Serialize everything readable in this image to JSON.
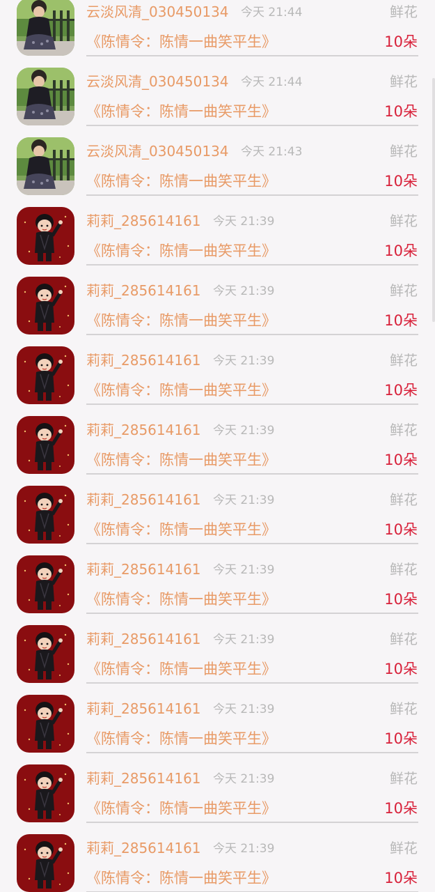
{
  "colors": {
    "name": "#e89a66",
    "book": "#e89a66",
    "time": "#b8b8b8",
    "gift_type": "#b8b8b8",
    "count": "#d8213a",
    "divider": "#d4d2d4",
    "background": "#f7f5f7"
  },
  "rows": [
    {
      "avatar": "avatar-kid-icon",
      "name": "云淡风清_030450134",
      "time": "今天 21:44",
      "gift_type": "鲜花",
      "book": "《陈情令：陈情一曲笑平生》",
      "count": "10朵"
    },
    {
      "avatar": "avatar-kid-icon",
      "name": "云淡风清_030450134",
      "time": "今天 21:44",
      "gift_type": "鲜花",
      "book": "《陈情令：陈情一曲笑平生》",
      "count": "10朵"
    },
    {
      "avatar": "avatar-kid-icon",
      "name": "云淡风清_030450134",
      "time": "今天 21:43",
      "gift_type": "鲜花",
      "book": "《陈情令：陈情一曲笑平生》",
      "count": "10朵"
    },
    {
      "avatar": "avatar-cartoon-icon",
      "name": "莉莉_285614161",
      "time": "今天 21:39",
      "gift_type": "鲜花",
      "book": "《陈情令：陈情一曲笑平生》",
      "count": "10朵"
    },
    {
      "avatar": "avatar-cartoon-icon",
      "name": "莉莉_285614161",
      "time": "今天 21:39",
      "gift_type": "鲜花",
      "book": "《陈情令：陈情一曲笑平生》",
      "count": "10朵"
    },
    {
      "avatar": "avatar-cartoon-icon",
      "name": "莉莉_285614161",
      "time": "今天 21:39",
      "gift_type": "鲜花",
      "book": "《陈情令：陈情一曲笑平生》",
      "count": "10朵"
    },
    {
      "avatar": "avatar-cartoon-icon",
      "name": "莉莉_285614161",
      "time": "今天 21:39",
      "gift_type": "鲜花",
      "book": "《陈情令：陈情一曲笑平生》",
      "count": "10朵"
    },
    {
      "avatar": "avatar-cartoon-icon",
      "name": "莉莉_285614161",
      "time": "今天 21:39",
      "gift_type": "鲜花",
      "book": "《陈情令：陈情一曲笑平生》",
      "count": "10朵"
    },
    {
      "avatar": "avatar-cartoon-icon",
      "name": "莉莉_285614161",
      "time": "今天 21:39",
      "gift_type": "鲜花",
      "book": "《陈情令：陈情一曲笑平生》",
      "count": "10朵"
    },
    {
      "avatar": "avatar-cartoon-icon",
      "name": "莉莉_285614161",
      "time": "今天 21:39",
      "gift_type": "鲜花",
      "book": "《陈情令：陈情一曲笑平生》",
      "count": "10朵"
    },
    {
      "avatar": "avatar-cartoon-icon",
      "name": "莉莉_285614161",
      "time": "今天 21:39",
      "gift_type": "鲜花",
      "book": "《陈情令：陈情一曲笑平生》",
      "count": "10朵"
    },
    {
      "avatar": "avatar-cartoon-icon",
      "name": "莉莉_285614161",
      "time": "今天 21:39",
      "gift_type": "鲜花",
      "book": "《陈情令：陈情一曲笑平生》",
      "count": "10朵"
    },
    {
      "avatar": "avatar-cartoon-icon",
      "name": "莉莉_285614161",
      "time": "今天 21:39",
      "gift_type": "鲜花",
      "book": "《陈情令：陈情一曲笑平生》",
      "count": "10朵"
    }
  ]
}
